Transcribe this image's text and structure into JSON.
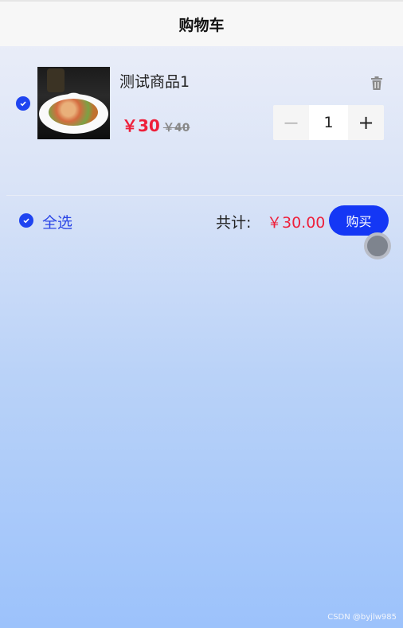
{
  "header": {
    "title": "购物车"
  },
  "cart": {
    "items": [
      {
        "name": "测试商品1",
        "price": "￥30",
        "original_price": "￥40",
        "quantity": "1",
        "checked": true,
        "image_icon": "food-dish-photo"
      }
    ]
  },
  "stepper": {
    "minus": "－",
    "plus": "+"
  },
  "footer": {
    "select_all_label": "全选",
    "total_label": "共计:",
    "total_value": "￥30.00",
    "buy_label": "购买"
  },
  "watermark": "CSDN @byjlw985",
  "colors": {
    "accent": "#1437f5",
    "price": "#ee1f3a"
  }
}
